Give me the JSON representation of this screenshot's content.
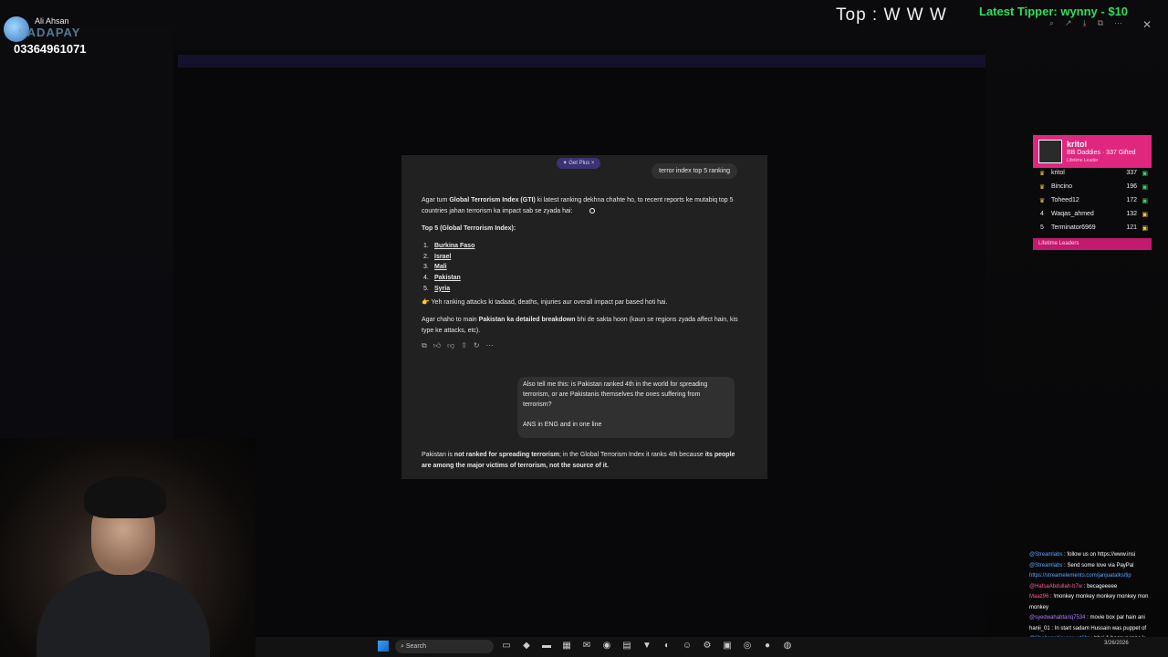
{
  "overlay": {
    "streamer_name": "Ali Ahsan",
    "pay_brand": "SADAPAY",
    "phone": "03364961071",
    "top_tip": "Top : W W W",
    "latest_tipper": "Latest Tipper: wynny - $10"
  },
  "chat": {
    "get_plus": "✦ Get Plus ×",
    "user_query_1": "terror index top 5 ranking",
    "intro_pre": "Agar tum ",
    "intro_bold": "Global Terrorism Index (GTI)",
    "intro_post": " ki latest ranking dekhna chahte ho, to recent reports ke mutabiq top 5 countries jahan terrorism ka impact sab se zyada hai:",
    "list_title": "Top 5 (Global Terrorism Index):",
    "list": [
      {
        "n": "1.",
        "c": "Burkina Faso"
      },
      {
        "n": "2.",
        "c": "Israel"
      },
      {
        "n": "3.",
        "c": "Mali"
      },
      {
        "n": "4.",
        "c": "Pakistan"
      },
      {
        "n": "5.",
        "c": "Syria"
      }
    ],
    "note": "👉 Yeh ranking attacks ki tadaad, deaths, injuries aur overall impact par based hoti hai.",
    "offer_pre": "Agar chaho to main ",
    "offer_bold": "Pakistan ka detailed breakdown",
    "offer_post": " bhi de sakta hoon (kaun se regions zyada affect hain, kis type ke attacks, etc).",
    "user_query_2a": "Also tell me this: is Pakistan ranked 4th in the world for spreading terrorism, or are Pakistanis themselves the ones suffering from terrorism?",
    "user_query_2b": "ANS in ENG and in one line",
    "answer_pre": "Pakistan is ",
    "answer_b1": "not ranked for spreading terrorism",
    "answer_mid": "; in the Global Terrorism Index it ranks 4th because ",
    "answer_b2": "its people are among the major victims of terrorism, not the source of it."
  },
  "leaderboard": {
    "top_name": "kritol",
    "top_sub": "BB Daddies · 337 Gifted",
    "top_sub2": "Lifetime Leader",
    "rows": [
      {
        "rank": "♛",
        "user": "kritol",
        "count": "337"
      },
      {
        "rank": "♛",
        "user": "Bincino",
        "count": "196"
      },
      {
        "rank": "♛",
        "user": "Toheed12",
        "count": "172"
      },
      {
        "rank": "4",
        "user": "Waqas_ahmed",
        "count": "132"
      },
      {
        "rank": "5",
        "user": "Terminator6969",
        "count": "121"
      }
    ],
    "footer": "Lifetime Leaders"
  },
  "stream_chat": [
    {
      "user": "@Streamlabs",
      "text": " : follow us on https://www.insi",
      "cls": "u-blue"
    },
    {
      "user": "@Streamlabs",
      "text": " : Send some love via PayPal",
      "cls": "u-blue"
    },
    {
      "user": "",
      "text": "https://streamelements.com/janjuatalks/tip",
      "cls": "u-blue"
    },
    {
      "user": "@HafsaAbdullah-b7w",
      "text": " : becageeeee",
      "cls": "u-pink"
    },
    {
      "user": "Maaz96",
      "text": " : !monkey monkey monkey monkey mon",
      "cls": "u-pink"
    },
    {
      "user": "",
      "text": "monkey",
      "cls": ""
    },
    {
      "user": "@syedwahabtariq7534",
      "text": " : movie box par hain ani",
      "cls": "u-purple"
    },
    {
      "user": "hanii_01",
      "text": " : In start sadam Hussain was puppet of",
      "cls": ""
    },
    {
      "user": "@ShabanaKouser-vd6br",
      "text": " : bhai 1 hogayaapne k",
      "cls": "u-blue"
    },
    {
      "user": "",
      "text": "gaming",
      "cls": ""
    }
  ],
  "taskbar": {
    "search": "Search",
    "tray_time": "3/26/2026"
  }
}
